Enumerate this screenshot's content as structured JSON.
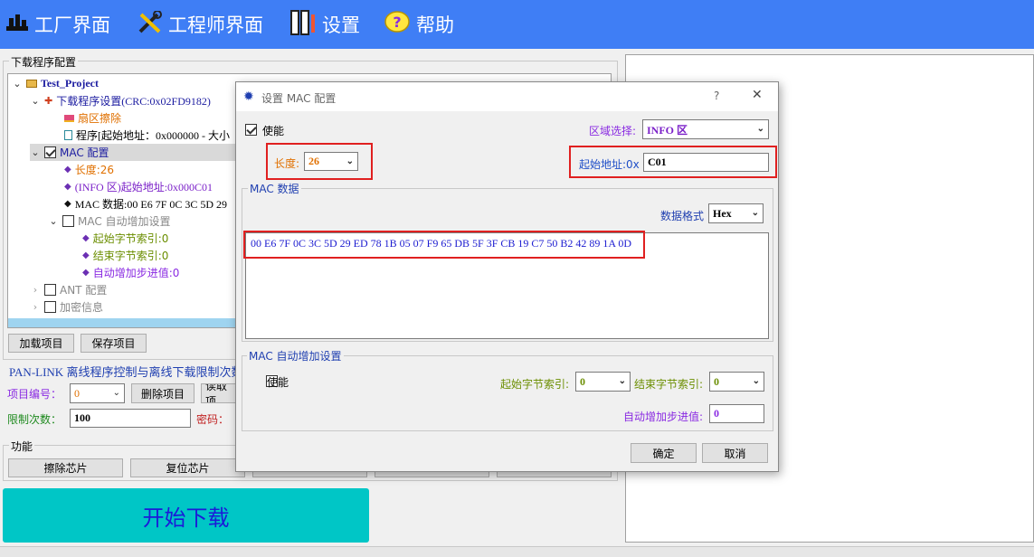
{
  "menu": {
    "factory": "工厂界面",
    "engineer": "工程师界面",
    "settings": "设置",
    "help": "帮助"
  },
  "download_group": {
    "title": "下载程序配置",
    "tree": {
      "project": "Test_Project",
      "program_settings": "下载程序设置(CRC:0x02FD9182)",
      "sector_erase": "扇区擦除",
      "program": "程序[起始地址：0x000000 - 大小",
      "mac_config": "MAC 配置",
      "length": "长度:26",
      "info_addr": "(INFO 区)起始地址:0x000C01",
      "mac_data": "MAC 数据:00 E6 7F 0C 3C 5D 29",
      "mac_auto": "MAC 自动增加设置",
      "start_idx": "起始字节索引:0",
      "end_idx": "结束字节索引:0",
      "auto_step": "自动增加步进值:0",
      "ant": "ANT 配置",
      "encrypt": "加密信息"
    },
    "load_project": "加载项目",
    "save_project": "保存项目"
  },
  "panlink": {
    "title": "PAN-LINK 离线程序控制与离线下载限制次数",
    "project_no_label": "项目编号：",
    "project_no_value": "0",
    "delete_project": "删除项目",
    "read_project": "读取项",
    "limit_label": "限制次数：",
    "limit_value": "100",
    "password_label": "密码："
  },
  "function": {
    "title": "功能",
    "erase_chip": "擦除芯片",
    "reset_chip": "复位芯片"
  },
  "start_download": "开始下载",
  "dialog": {
    "title": "设置 MAC 配置",
    "help": "?",
    "close": "✕",
    "enable_label": "使能",
    "region_label": "区域选择:",
    "region_value": "INFO 区",
    "length_label": "长度:",
    "length_value": "26",
    "start_addr_label": "起始地址:0x",
    "start_addr_value": "C01",
    "mac_data_title": "MAC 数据",
    "data_format_label": "数据格式",
    "data_format_value": "Hex",
    "mac_hex": "00 E6 7F 0C 3C 5D 29 ED 78 1B 05 07 F9 65 DB 5F 3F CB 19 C7 50 B2 42 89 1A 0D",
    "auto_title": "MAC 自动增加设置",
    "auto_enable_label": "使能",
    "start_idx_label": "起始字节索引:",
    "start_idx_value": "0",
    "end_idx_label": "结束字节索引:",
    "end_idx_value": "0",
    "step_label": "自动增加步进值:",
    "step_value": "0",
    "ok": "确定",
    "cancel": "取消"
  },
  "colors": {
    "menubar": "#3f7ef5",
    "start_button": "#00c6c6",
    "start_text": "#1b1bd8",
    "highlight_box": "#e02020",
    "label_blue": "#1f4fc8",
    "label_orange": "#e07000",
    "label_purple": "#8a2be2",
    "label_olive": "#6b8e00"
  }
}
